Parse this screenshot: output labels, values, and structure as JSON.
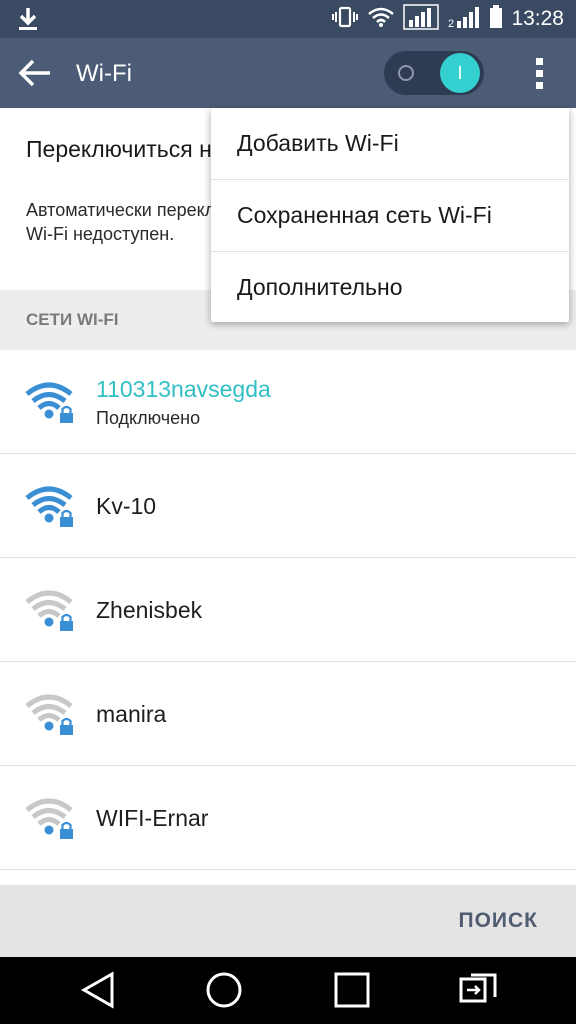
{
  "status_bar": {
    "time": "13:28",
    "icons": [
      "download-icon",
      "vibrate-icon",
      "wifi-icon",
      "signal-icon",
      "signal-icon",
      "battery-icon"
    ]
  },
  "app_bar": {
    "title": "Wi-Fi",
    "toggle_on_label": "I",
    "toggle_state": "on"
  },
  "switch_section": {
    "title": "Переключиться на мобильные данные",
    "description": "Автоматически переключиться на мобильные данные, если Wi-Fi недоступен."
  },
  "section_header": "СЕТИ WI-FI",
  "networks": [
    {
      "name": "110313navsegda",
      "status": "Подключено",
      "connected": true
    },
    {
      "name": "Kv-10",
      "status": "",
      "connected": false
    },
    {
      "name": "Zhenisbek",
      "status": "",
      "connected": false
    },
    {
      "name": "manira",
      "status": "",
      "connected": false
    },
    {
      "name": "WIFI-Ernar",
      "status": "",
      "connected": false
    }
  ],
  "menu": {
    "items": [
      "Добавить Wi-Fi",
      "Сохраненная сеть Wi-Fi",
      "Дополнительно"
    ]
  },
  "action_bar": {
    "search_label": "ПОИСК"
  },
  "colors": {
    "status_bar": "#3a4a63",
    "app_bar": "#4c5b76",
    "accent": "#33d0cf",
    "wifi_strong": "#3a8fd4",
    "wifi_weak": "#c8c8c8"
  }
}
